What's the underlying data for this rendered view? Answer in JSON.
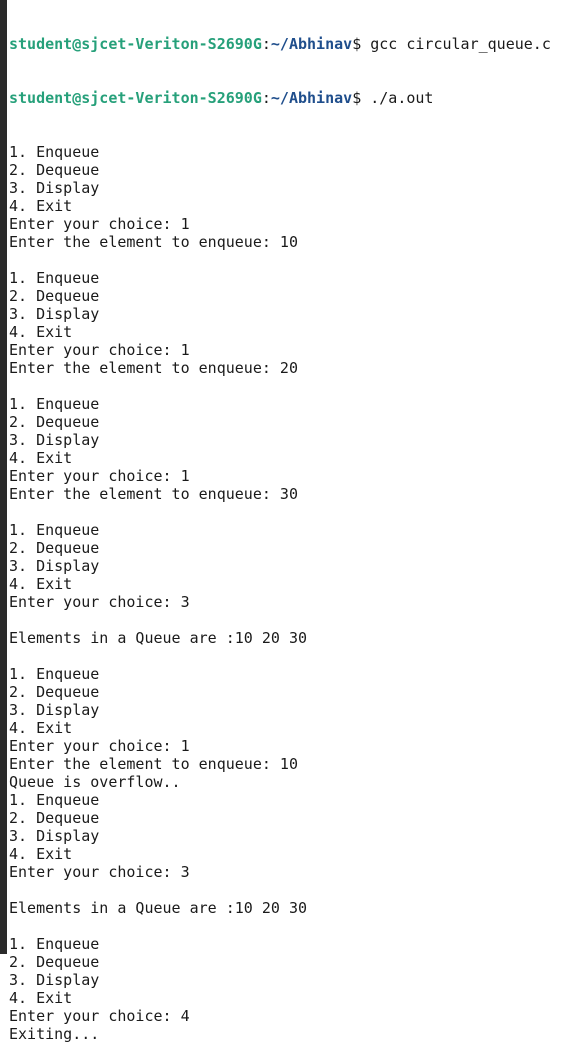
{
  "prompt": {
    "user_host": "student@sjcet-Veriton-S2690G",
    "path": "~/Abhinav",
    "colors": {
      "user_host": "#26a07a",
      "path": "#1f4e8c"
    }
  },
  "commands": [
    "gcc circular_queue.c",
    "./a.out"
  ],
  "output": [
    "",
    "1. Enqueue",
    "2. Dequeue",
    "3. Display",
    "4. Exit",
    "Enter your choice: 1",
    "Enter the element to enqueue: 10",
    "",
    "1. Enqueue",
    "2. Dequeue",
    "3. Display",
    "4. Exit",
    "Enter your choice: 1",
    "Enter the element to enqueue: 20",
    "",
    "1. Enqueue",
    "2. Dequeue",
    "3. Display",
    "4. Exit",
    "Enter your choice: 1",
    "Enter the element to enqueue: 30",
    "",
    "1. Enqueue",
    "2. Dequeue",
    "3. Display",
    "4. Exit",
    "Enter your choice: 3",
    "",
    "Elements in a Queue are :10 20 30",
    "",
    "1. Enqueue",
    "2. Dequeue",
    "3. Display",
    "4. Exit",
    "Enter your choice: 1",
    "Enter the element to enqueue: 10",
    "Queue is overflow..",
    "1. Enqueue",
    "2. Dequeue",
    "3. Display",
    "4. Exit",
    "Enter your choice: 3",
    "",
    "Elements in a Queue are :10 20 30",
    "",
    "1. Enqueue",
    "2. Dequeue",
    "3. Display",
    "4. Exit",
    "Enter your choice: 4",
    "Exiting..."
  ]
}
